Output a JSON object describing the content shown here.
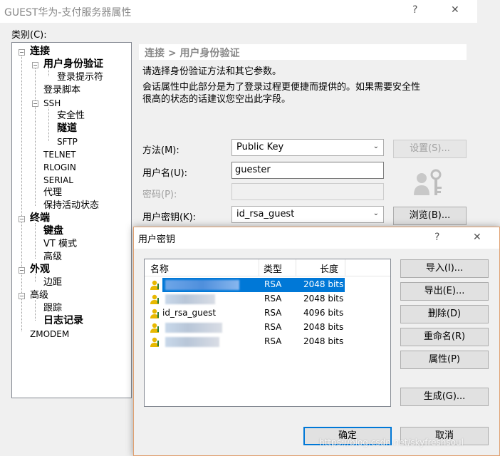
{
  "window": {
    "title": "GUEST华为-支付服务器属性",
    "help_glyph": "?",
    "close_glyph": "✕",
    "category_label": "类别(C):"
  },
  "tree": {
    "connection": "连接",
    "auth": "用户身份验证",
    "login_prompt": "登录提示符",
    "login_script": "登录脚本",
    "ssh": "SSH",
    "security": "安全性",
    "tunnel": "隧道",
    "sftp": "SFTP",
    "telnet": "TELNET",
    "rlogin": "RLOGIN",
    "serial": "SERIAL",
    "proxy": "代理",
    "keepalive": "保持活动状态",
    "terminal": "终端",
    "keyboard": "键盘",
    "vt_mode": "VT 模式",
    "advanced1": "高级",
    "appearance": "外观",
    "margin": "边距",
    "advanced2": "高级",
    "trace": "跟踪",
    "logging": "日志记录",
    "zmodem": "ZMODEM"
  },
  "panel": {
    "header": "连接 > 用户身份验证",
    "intro": "请选择身份验证方法和其它参数。",
    "note_line1": "会话属性中此部分是为了登录过程更便捷而提供的。如果需要安全性",
    "note_line2": "很高的状态的话建议您空出此字段。",
    "method_label": "方法(M):",
    "method_value": "Public Key",
    "settings_button": "设置(S)...",
    "username_label": "用户名(U):",
    "username_value": "guester",
    "password_label": "密码(P):",
    "password_value": "",
    "userkey_label": "用户密钥(K):",
    "userkey_value": "id_rsa_guest",
    "browse_button": "浏览(B)..."
  },
  "dialog": {
    "title": "用户密钥",
    "help_glyph": "?",
    "close_glyph": "✕",
    "columns": {
      "name": "名称",
      "type": "类型",
      "length": "长度"
    },
    "rows": [
      {
        "name": "",
        "type": "RSA",
        "length": "2048 bits",
        "selected": true
      },
      {
        "name": "",
        "type": "RSA",
        "length": "2048 bits",
        "selected": false
      },
      {
        "name": "id_rsa_guest",
        "type": "RSA",
        "length": "4096 bits",
        "selected": false
      },
      {
        "name": "",
        "type": "RSA",
        "length": "2048 bits",
        "selected": false
      },
      {
        "name": "",
        "type": "RSA",
        "length": "2048 bits",
        "selected": false
      }
    ],
    "import_button": "导入(I)...",
    "export_button": "导出(E)...",
    "delete_button": "删除(D)",
    "rename_button": "重命名(R)",
    "properties_button": "属性(P)",
    "generate_button": "生成(G)...",
    "ok_button": "确定",
    "cancel_button": "取消"
  },
  "watermark": "https://blog.csdn.net/skyfreshsoul"
}
